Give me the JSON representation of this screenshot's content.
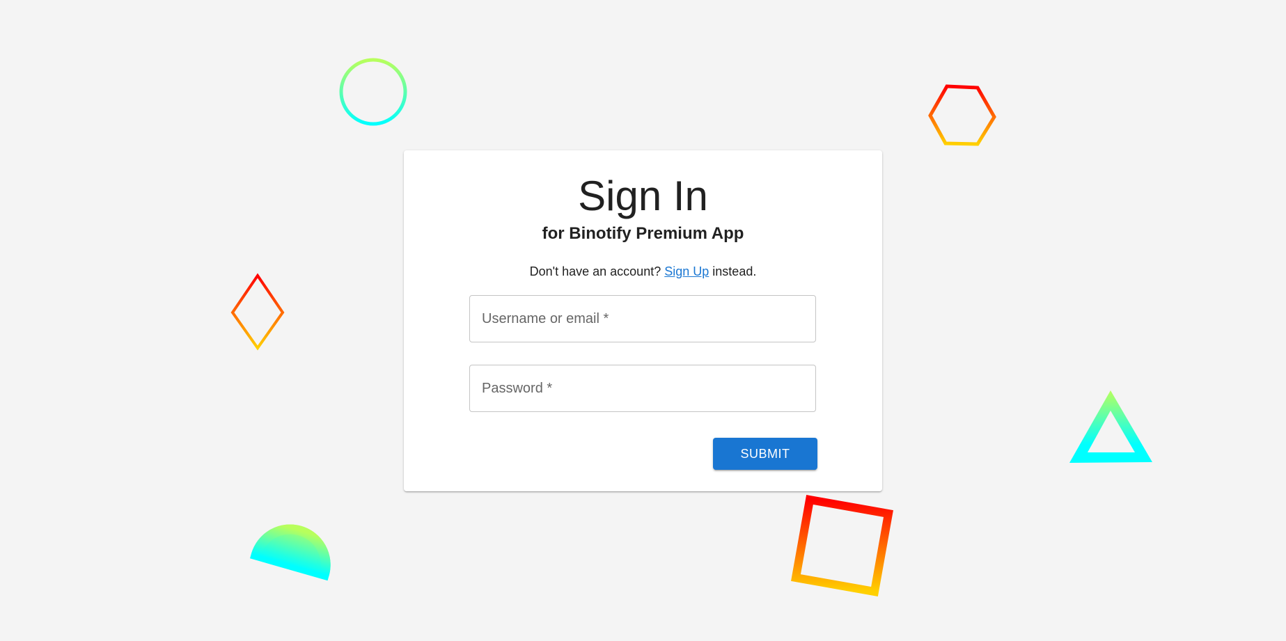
{
  "signin": {
    "title": "Sign In",
    "subtitle": "for Binotify Premium App",
    "signup_prefix": "Don't have an account?",
    "signup_link": "Sign Up",
    "signup_suffix": "instead.",
    "username_placeholder": "Username or email *",
    "username_value": "",
    "password_placeholder": "Password *",
    "password_value": "",
    "submit_label": "SUBMIT"
  },
  "colors": {
    "background": "#f4f4f4",
    "card": "#ffffff",
    "primary": "#1976d2",
    "link": "#1976d2",
    "gradient_cool_start": "#b8ff5c",
    "gradient_cool_end": "#00ffff",
    "gradient_warm_start": "#ff0000",
    "gradient_warm_end": "#ffd000"
  },
  "decorations": [
    {
      "name": "circle-outline-shape",
      "gradient": "cool"
    },
    {
      "name": "hexagon-outline-shape",
      "gradient": "warm"
    },
    {
      "name": "diamond-outline-shape",
      "gradient": "warm"
    },
    {
      "name": "triangle-outline-shape",
      "gradient": "cool"
    },
    {
      "name": "half-circle-outline-shape",
      "gradient": "cool"
    },
    {
      "name": "square-outline-shape",
      "gradient": "warm"
    }
  ]
}
